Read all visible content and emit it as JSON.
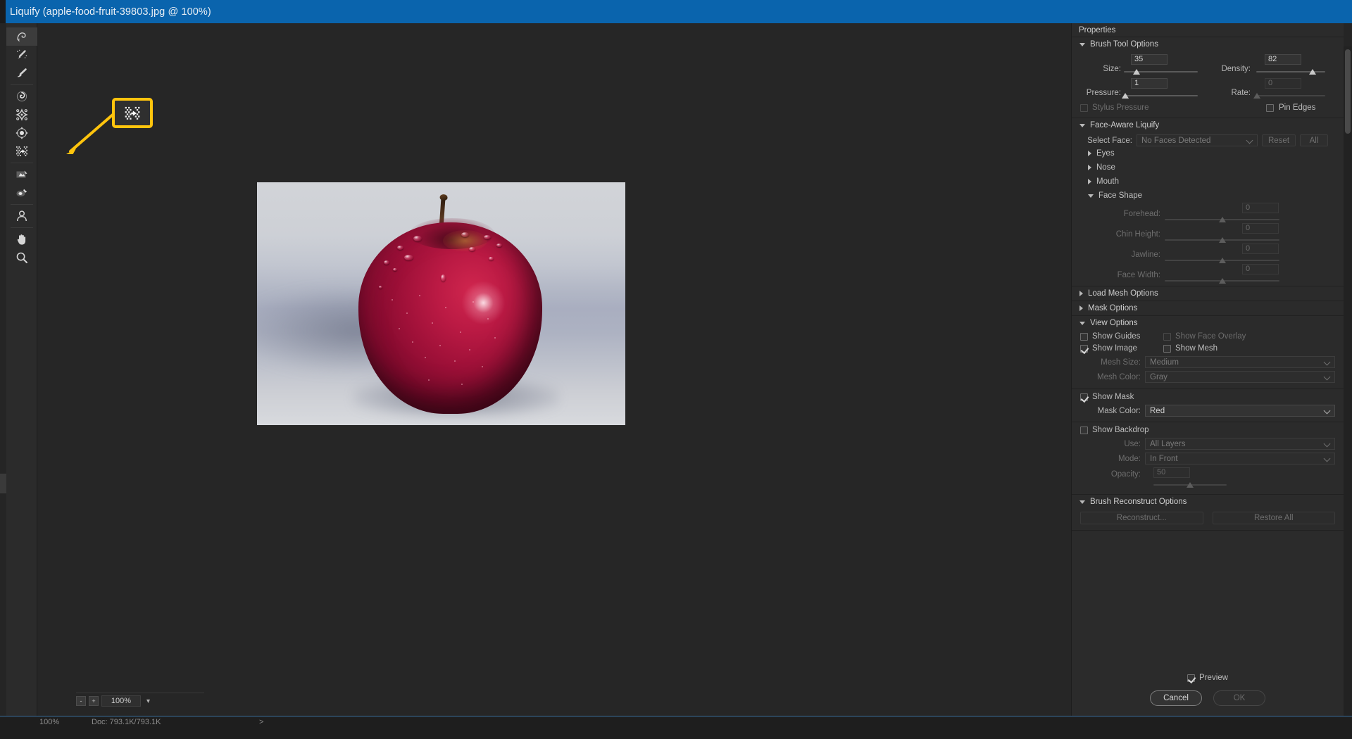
{
  "window": {
    "title": "Liquify (apple-food-fruit-39803.jpg @ 100%)"
  },
  "toolbar": {
    "tools": [
      {
        "name": "forward-warp-tool",
        "label": "Forward Warp Tool",
        "selected": true
      },
      {
        "name": "reconstruct-tool",
        "label": "Reconstruct Tool",
        "selected": false
      },
      {
        "name": "smooth-tool",
        "label": "Smooth Tool",
        "selected": false
      },
      {
        "name": "twirl-clockwise-tool",
        "label": "Twirl Clockwise Tool",
        "selected": false
      },
      {
        "name": "pucker-tool",
        "label": "Pucker Tool",
        "selected": false
      },
      {
        "name": "bloat-tool",
        "label": "Bloat Tool",
        "selected": false
      },
      {
        "name": "push-left-tool",
        "label": "Push Left Tool",
        "selected": false
      },
      {
        "name": "freeze-mask-tool",
        "label": "Freeze Mask Tool",
        "selected": false
      },
      {
        "name": "thaw-mask-tool",
        "label": "Thaw Mask Tool",
        "selected": false
      },
      {
        "name": "face-tool",
        "label": "Face Tool",
        "selected": false
      },
      {
        "name": "hand-tool",
        "label": "Hand Tool",
        "selected": false
      },
      {
        "name": "zoom-tool",
        "label": "Zoom Tool",
        "selected": false
      }
    ]
  },
  "callout": {
    "highlighted_tool": "Push Left Tool",
    "border_color": "#ffc40d",
    "arrow_color": "#ffc40d"
  },
  "canvas": {
    "image_alt": "Red apple with water droplets on grey background",
    "zoom_level": "100%",
    "zoom_out_label": "-",
    "zoom_in_label": "+"
  },
  "properties": {
    "panel_title": "Properties",
    "brush_tool_options": {
      "title": "Brush Tool Options",
      "expanded": true,
      "size": {
        "label": "Size:",
        "value": "35",
        "slider_pct": 17
      },
      "density": {
        "label": "Density:",
        "value": "82",
        "slider_pct": 82
      },
      "pressure": {
        "label": "Pressure:",
        "value": "1",
        "slider_pct": 1
      },
      "rate": {
        "label": "Rate:",
        "value": "0",
        "slider_pct": 0,
        "disabled": true
      },
      "stylus_pressure": {
        "label": "Stylus Pressure",
        "checked": false,
        "disabled": true
      },
      "pin_edges": {
        "label": "Pin Edges",
        "checked": false
      }
    },
    "face_aware_liquify": {
      "title": "Face-Aware Liquify",
      "expanded": true,
      "select_face": {
        "label": "Select Face:",
        "value": "No Faces Detected",
        "disabled": true
      },
      "reset_label": "Reset",
      "all_label": "All",
      "groups": [
        {
          "name": "eyes",
          "label": "Eyes",
          "expanded": false
        },
        {
          "name": "nose",
          "label": "Nose",
          "expanded": false
        },
        {
          "name": "mouth",
          "label": "Mouth",
          "expanded": false
        }
      ],
      "face_shape": {
        "label": "Face Shape",
        "expanded": true,
        "sliders": [
          {
            "name": "forehead",
            "label": "Forehead:",
            "value": "0",
            "slider_pct": 50
          },
          {
            "name": "chin-height",
            "label": "Chin Height:",
            "value": "0",
            "slider_pct": 50
          },
          {
            "name": "jawline",
            "label": "Jawline:",
            "value": "0",
            "slider_pct": 50
          },
          {
            "name": "face-width",
            "label": "Face Width:",
            "value": "0",
            "slider_pct": 50
          }
        ]
      }
    },
    "load_mesh_options": {
      "title": "Load Mesh Options",
      "expanded": false
    },
    "mask_options": {
      "title": "Mask Options",
      "expanded": false
    },
    "view_options": {
      "title": "View Options",
      "expanded": true,
      "show_guides": {
        "label": "Show Guides",
        "checked": false
      },
      "show_face_overlay": {
        "label": "Show Face Overlay",
        "checked": false,
        "disabled": true
      },
      "show_image": {
        "label": "Show Image",
        "checked": true
      },
      "show_mesh": {
        "label": "Show Mesh",
        "checked": false
      },
      "mesh_size": {
        "label": "Mesh Size:",
        "value": "Medium",
        "disabled": true
      },
      "mesh_color": {
        "label": "Mesh Color:",
        "value": "Gray",
        "disabled": true
      },
      "show_mask": {
        "label": "Show Mask",
        "checked": true
      },
      "mask_color": {
        "label": "Mask Color:",
        "value": "Red",
        "disabled": false
      },
      "show_backdrop": {
        "label": "Show Backdrop",
        "checked": false
      },
      "backdrop_use": {
        "label": "Use:",
        "value": "All Layers",
        "disabled": true
      },
      "backdrop_mode": {
        "label": "Mode:",
        "value": "In Front",
        "disabled": true
      },
      "backdrop_opacity": {
        "label": "Opacity:",
        "value": "50",
        "slider_pct": 50,
        "disabled": true
      }
    },
    "brush_reconstruct_options": {
      "title": "Brush Reconstruct Options",
      "expanded": true,
      "reconstruct_label": "Reconstruct...",
      "restore_all_label": "Restore All"
    },
    "footer": {
      "preview": {
        "label": "Preview",
        "checked": true
      },
      "cancel_label": "Cancel",
      "ok_label": "OK",
      "ok_disabled": true
    }
  },
  "status_bar": {
    "zoom": "100%",
    "doc_info": "Doc: 793.1K/793.1K",
    "arrow": ">"
  }
}
